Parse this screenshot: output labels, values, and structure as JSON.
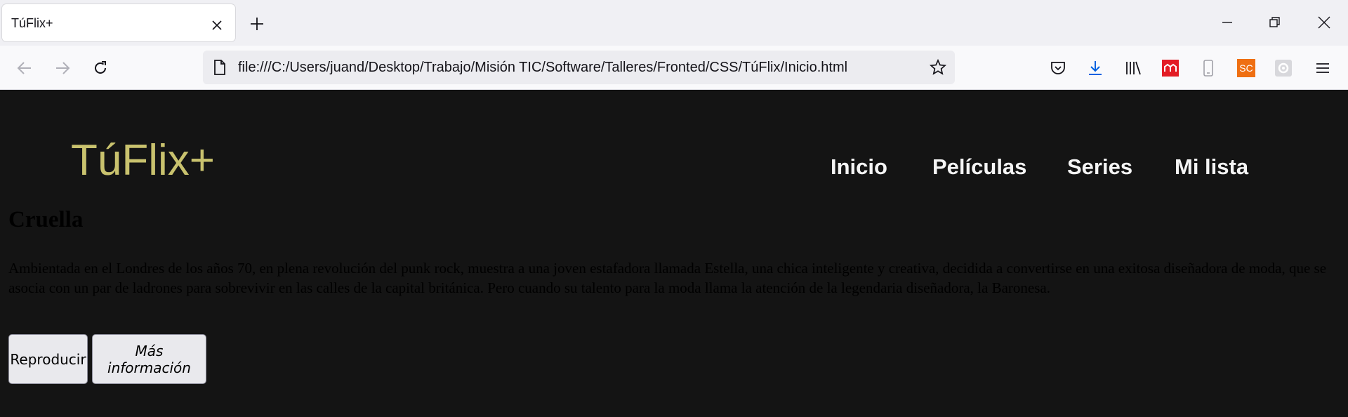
{
  "browser": {
    "tab_title": "TúFlix+",
    "url": "file:///C:/Users/juand/Desktop/Trabajo/Misión TIC/Software/Talleres/Fronted/CSS/TúFlix/Inicio.html",
    "toolbar_icons": [
      "pocket-icon",
      "downloads-icon",
      "library-icon",
      "extension-red-icon",
      "device-icon",
      "extension-sc-icon",
      "extension-gear-icon",
      "menu-icon"
    ],
    "extension_sc_label": "SC",
    "colors": {
      "accent_download": "#0061e0",
      "ext_red": "#e31c25",
      "ext_sc": "#ef6f12"
    }
  },
  "site": {
    "logo": "TúFlix+",
    "logo_color": "#c9c26e",
    "nav": [
      "Inicio",
      "Películas",
      "Series",
      "Mi lista"
    ]
  },
  "hero": {
    "title": "Cruella",
    "description": "Ambientada en el Londres de los años 70, en plena revolución del punk rock, muestra a una joven estafadora llamada Estella, una chica inteligente y creativa, decidida a convertirse en una exitosa diseñadora de moda, que se asocia con un par de ladrones para sobrevivir en las calles de la capital británica. Pero cuando su talento para la moda llama la atención de la legendaria diseñadora, la Baronesa.",
    "play_label": "Reproducir",
    "info_label": "Más información"
  }
}
